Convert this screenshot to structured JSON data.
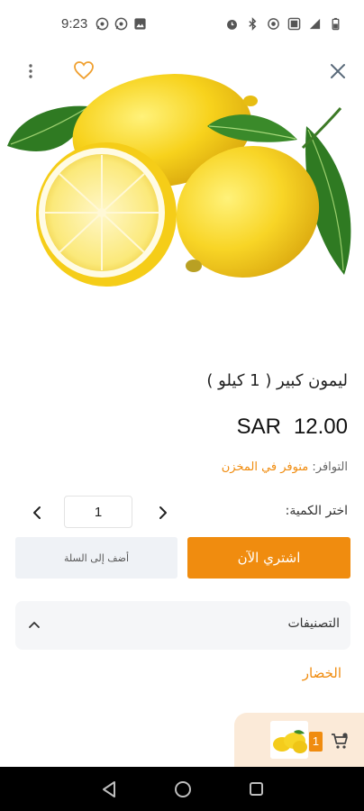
{
  "status_bar": {
    "time": "9:23",
    "left_icons": [
      "whatsapp-icon",
      "whatsapp-icon",
      "gallery-icon"
    ],
    "right_icons": [
      "alarm-icon",
      "bluetooth-icon",
      "hotspot-icon",
      "data-icon",
      "signal-icon",
      "battery-icon"
    ]
  },
  "top_actions": {
    "icons": [
      "more-vertical-icon",
      "heart-icon",
      "close-icon"
    ]
  },
  "product": {
    "title": "ليمون كبير ( 1 كيلو )",
    "price_amount": "12.00",
    "price_currency": "SAR",
    "availability_label": "التوافر:",
    "availability_value": "متوفر في المخزن"
  },
  "quantity": {
    "label": "اختر الكمية:",
    "value": "1"
  },
  "actions": {
    "buy_now": "اشتري الآن",
    "add_to_cart": "أضف إلى السلة"
  },
  "categories": {
    "title": "التصنيفات",
    "items": [
      "الخضار"
    ]
  },
  "cart": {
    "count": "1"
  },
  "colors": {
    "accent": "#f08c0f",
    "panel": "#f5f6f8",
    "cart_bg": "#fbead8"
  }
}
